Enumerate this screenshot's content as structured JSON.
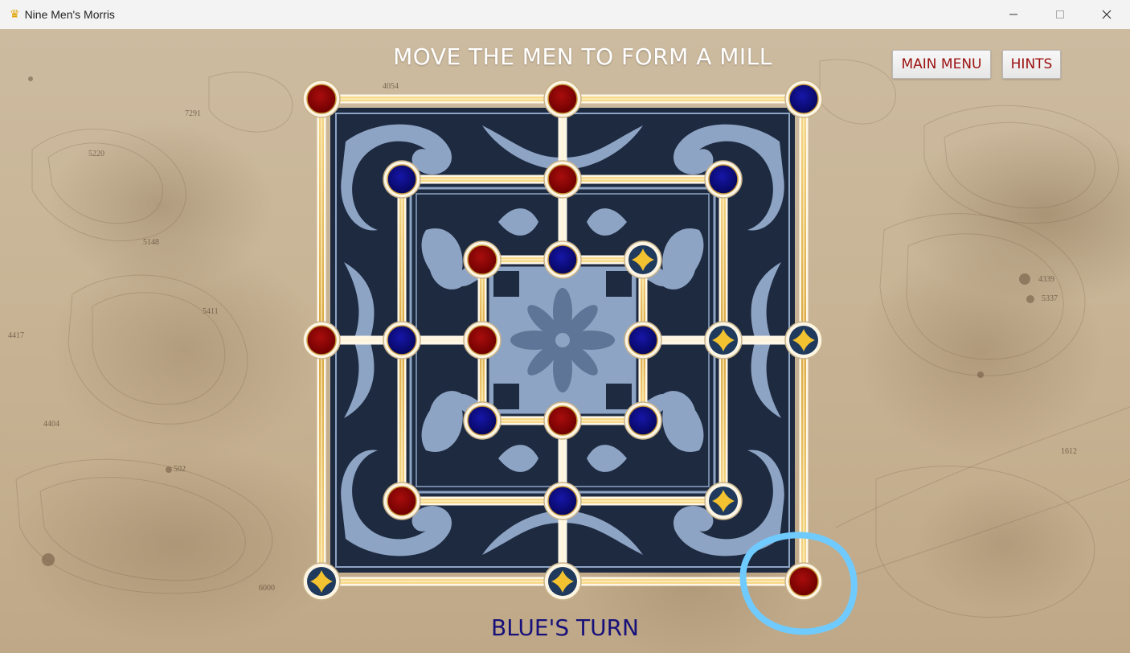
{
  "window": {
    "title": "Nine Men's Morris",
    "icon": "crown-icon"
  },
  "header": {
    "instruction": "MOVE THE MEN TO FORM A MILL"
  },
  "buttons": {
    "main_menu": "MAIN MENU",
    "hints": "HINTS"
  },
  "status": {
    "turn": "BLUE'S TURN"
  },
  "map_numbers": [
    "7291",
    "5220",
    "4054",
    "5148",
    "5411",
    "4404",
    "502",
    "6000",
    "4339",
    "5337",
    "4417",
    "1612"
  ],
  "colors": {
    "red_piece": "#8b0000",
    "blue_piece": "#0b0b8a",
    "empty_point": "#1f3a5c",
    "star": "#f2c230",
    "rail": "#f0c060",
    "highlight": "#6fcbff",
    "turn_text": "#16107a",
    "button_text": "#9b1010"
  },
  "board": {
    "points": [
      {
        "ring": "outer",
        "pos": "top-left",
        "state": "red"
      },
      {
        "ring": "outer",
        "pos": "top-middle",
        "state": "red"
      },
      {
        "ring": "outer",
        "pos": "top-right",
        "state": "blue"
      },
      {
        "ring": "middle",
        "pos": "top-left",
        "state": "blue"
      },
      {
        "ring": "middle",
        "pos": "top-middle",
        "state": "red"
      },
      {
        "ring": "middle",
        "pos": "top-right",
        "state": "blue"
      },
      {
        "ring": "inner",
        "pos": "top-left",
        "state": "red"
      },
      {
        "ring": "inner",
        "pos": "top-middle",
        "state": "blue"
      },
      {
        "ring": "inner",
        "pos": "top-right",
        "state": "empty"
      },
      {
        "ring": "outer",
        "pos": "middle-left",
        "state": "red"
      },
      {
        "ring": "middle",
        "pos": "middle-left",
        "state": "blue"
      },
      {
        "ring": "inner",
        "pos": "middle-left",
        "state": "red"
      },
      {
        "ring": "inner",
        "pos": "middle-right",
        "state": "blue"
      },
      {
        "ring": "middle",
        "pos": "middle-right",
        "state": "empty"
      },
      {
        "ring": "outer",
        "pos": "middle-right",
        "state": "empty"
      },
      {
        "ring": "inner",
        "pos": "bottom-left",
        "state": "blue"
      },
      {
        "ring": "inner",
        "pos": "bottom-middle",
        "state": "red"
      },
      {
        "ring": "inner",
        "pos": "bottom-right",
        "state": "blue"
      },
      {
        "ring": "middle",
        "pos": "bottom-left",
        "state": "red"
      },
      {
        "ring": "middle",
        "pos": "bottom-middle",
        "state": "blue"
      },
      {
        "ring": "middle",
        "pos": "bottom-right",
        "state": "empty"
      },
      {
        "ring": "outer",
        "pos": "bottom-left",
        "state": "empty"
      },
      {
        "ring": "outer",
        "pos": "bottom-middle",
        "state": "empty"
      },
      {
        "ring": "outer",
        "pos": "bottom-right",
        "state": "red",
        "highlighted": true
      }
    ]
  }
}
